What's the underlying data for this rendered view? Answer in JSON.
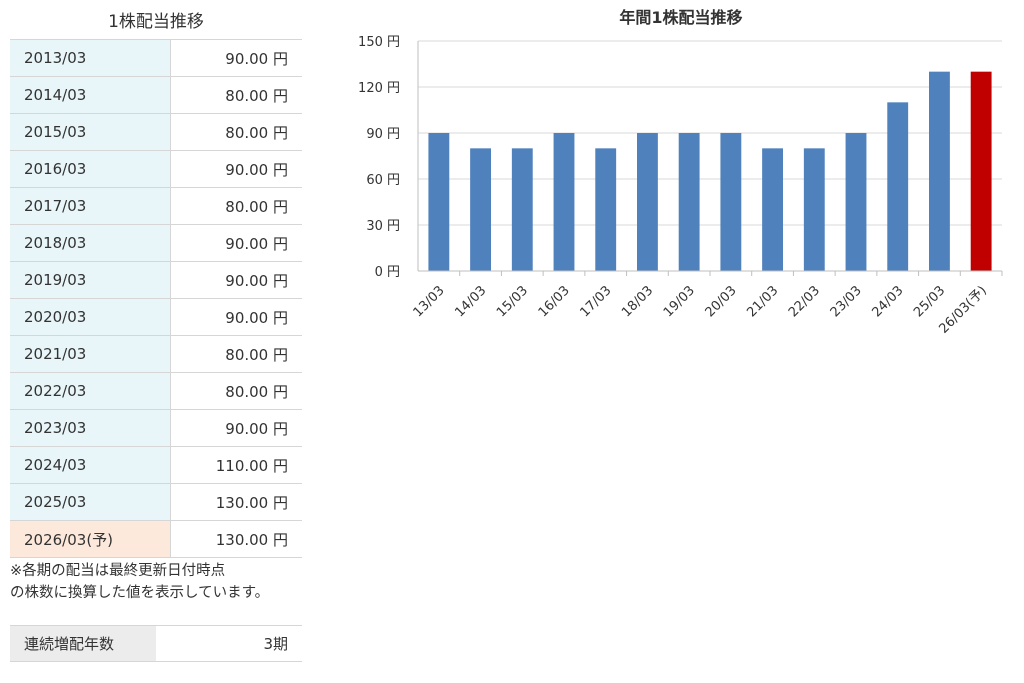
{
  "table": {
    "title": "1株配当推移",
    "rows": [
      {
        "period": "2013/03",
        "value": "90.00 円"
      },
      {
        "period": "2014/03",
        "value": "80.00 円"
      },
      {
        "period": "2015/03",
        "value": "80.00 円"
      },
      {
        "period": "2016/03",
        "value": "90.00 円"
      },
      {
        "period": "2017/03",
        "value": "80.00 円"
      },
      {
        "period": "2018/03",
        "value": "90.00 円"
      },
      {
        "period": "2019/03",
        "value": "90.00 円"
      },
      {
        "period": "2020/03",
        "value": "90.00 円"
      },
      {
        "period": "2021/03",
        "value": "80.00 円"
      },
      {
        "period": "2022/03",
        "value": "80.00 円"
      },
      {
        "period": "2023/03",
        "value": "90.00 円"
      },
      {
        "period": "2024/03",
        "value": "110.00 円"
      },
      {
        "period": "2025/03",
        "value": "130.00 円"
      },
      {
        "period": "2026/03(予)",
        "value": "130.00 円"
      }
    ],
    "note_line1": "※各期の配当は最終更新日付時点",
    "note_line2": "の株数に換算した値を表示しています。"
  },
  "streak": {
    "label": "連続増配年数",
    "value": "3期"
  },
  "colors": {
    "bar": "#4f81bd",
    "forecast_bar": "#c00000",
    "year_cell_bg": "#e8f5f9",
    "forecast_cell_bg": "#fde9dc",
    "grid": "#d9d9d9"
  },
  "chart_data": {
    "type": "bar",
    "title": "年間1株配当推移",
    "categories": [
      "13/03",
      "14/03",
      "15/03",
      "16/03",
      "17/03",
      "18/03",
      "19/03",
      "20/03",
      "21/03",
      "22/03",
      "23/03",
      "24/03",
      "25/03",
      "26/03(予)"
    ],
    "values": [
      90,
      80,
      80,
      90,
      80,
      90,
      90,
      90,
      80,
      80,
      90,
      110,
      130,
      130
    ],
    "forecast_index": 13,
    "ylim": [
      0,
      150
    ],
    "yticks": [
      0,
      30,
      60,
      90,
      120,
      150
    ],
    "ytick_suffix": " 円",
    "xlabel": "",
    "ylabel": "",
    "grid": true,
    "legend": "none"
  }
}
